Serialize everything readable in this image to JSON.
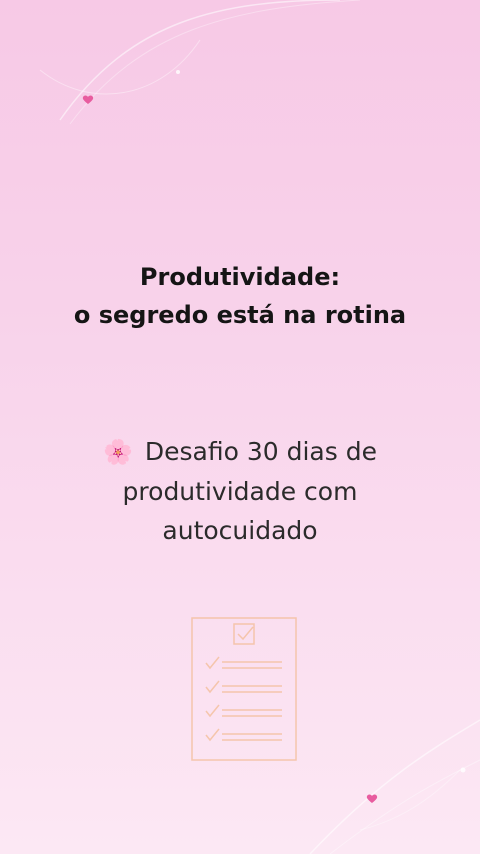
{
  "headline": {
    "line1": "Produtividade:",
    "line2": "o segredo está na rotina"
  },
  "subtitle": {
    "emoji": "🌸",
    "text": "Desafio 30 dias de produtividade com autocuidado"
  },
  "icons": {
    "flower": "cherry-blossom-icon",
    "checklist": "checklist-icon",
    "heart": "heart-icon"
  },
  "colors": {
    "background_top": "#f7c9e6",
    "background_bottom": "#fce8f4",
    "text_dark": "#151515",
    "checklist_stroke": "#f2b98e",
    "heart": "#e85c9f"
  }
}
